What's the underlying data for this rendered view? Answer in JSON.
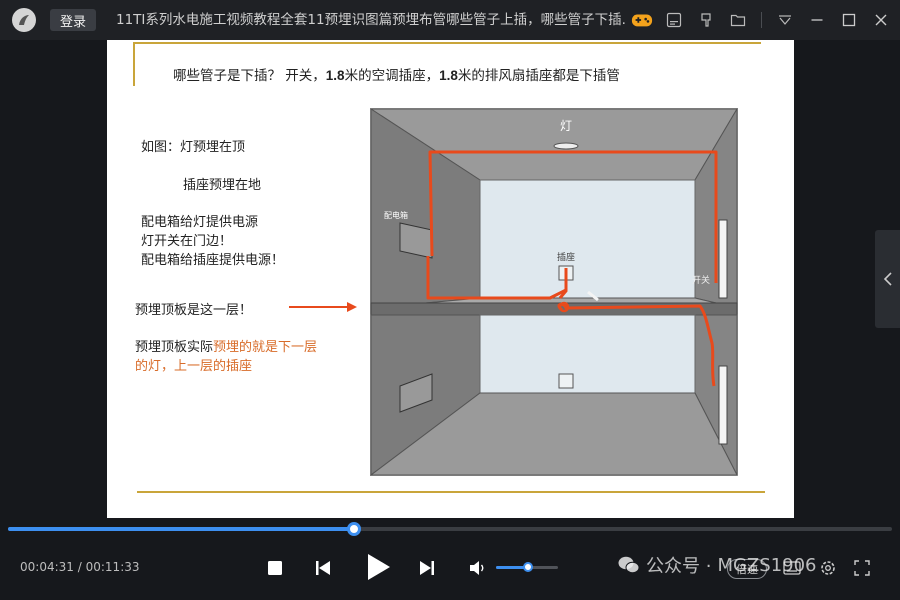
{
  "titlebar": {
    "login_label": "登录",
    "title": "11TI系列水电施工视频教程全套11预埋识图篇预埋布管哪些管子上插，哪些管子下插.m...",
    "icons": [
      "gamepad-icon",
      "subtitle-icon",
      "pin-icon",
      "folder-icon",
      "dropdown-icon",
      "minimize-icon",
      "maximize-icon",
      "close-icon"
    ]
  },
  "slide": {
    "heading_part1": "哪些管子是下插？ 开关，",
    "heading_num1": "1.8",
    "heading_part2": "米的空调插座，",
    "heading_num2": "1.8",
    "heading_part3": "米的排风扇插座都是下插管",
    "note1": "如图：灯预埋在顶",
    "note2": "插座预埋在地",
    "note3": "配电箱给灯提供电源",
    "note4": "灯开关在门边！",
    "note5": "配电箱给插座提供电源！",
    "note6": "预埋顶板是这一层！",
    "note7_dark": "预埋顶板实际",
    "note7_orange": "预埋的就是下一层",
    "note8": "的灯，上一层的插座",
    "diagram": {
      "label_light": "灯",
      "label_panel": "配电箱",
      "label_socket": "插座",
      "label_switch": "开关"
    }
  },
  "player": {
    "current_time": "00:04:31",
    "separator": "/",
    "total_time": "00:11:33",
    "progress_fraction": 0.391,
    "volume_fraction": 0.52,
    "speed_label": "倍速",
    "watermark_prefix": "公众号 · ",
    "watermark_id": "MGZS1906"
  },
  "colors": {
    "accent": "#3d8ff0",
    "wire": "#e84a1c",
    "slide_rule": "#c9a53a",
    "note_orange": "#d86c2a"
  }
}
